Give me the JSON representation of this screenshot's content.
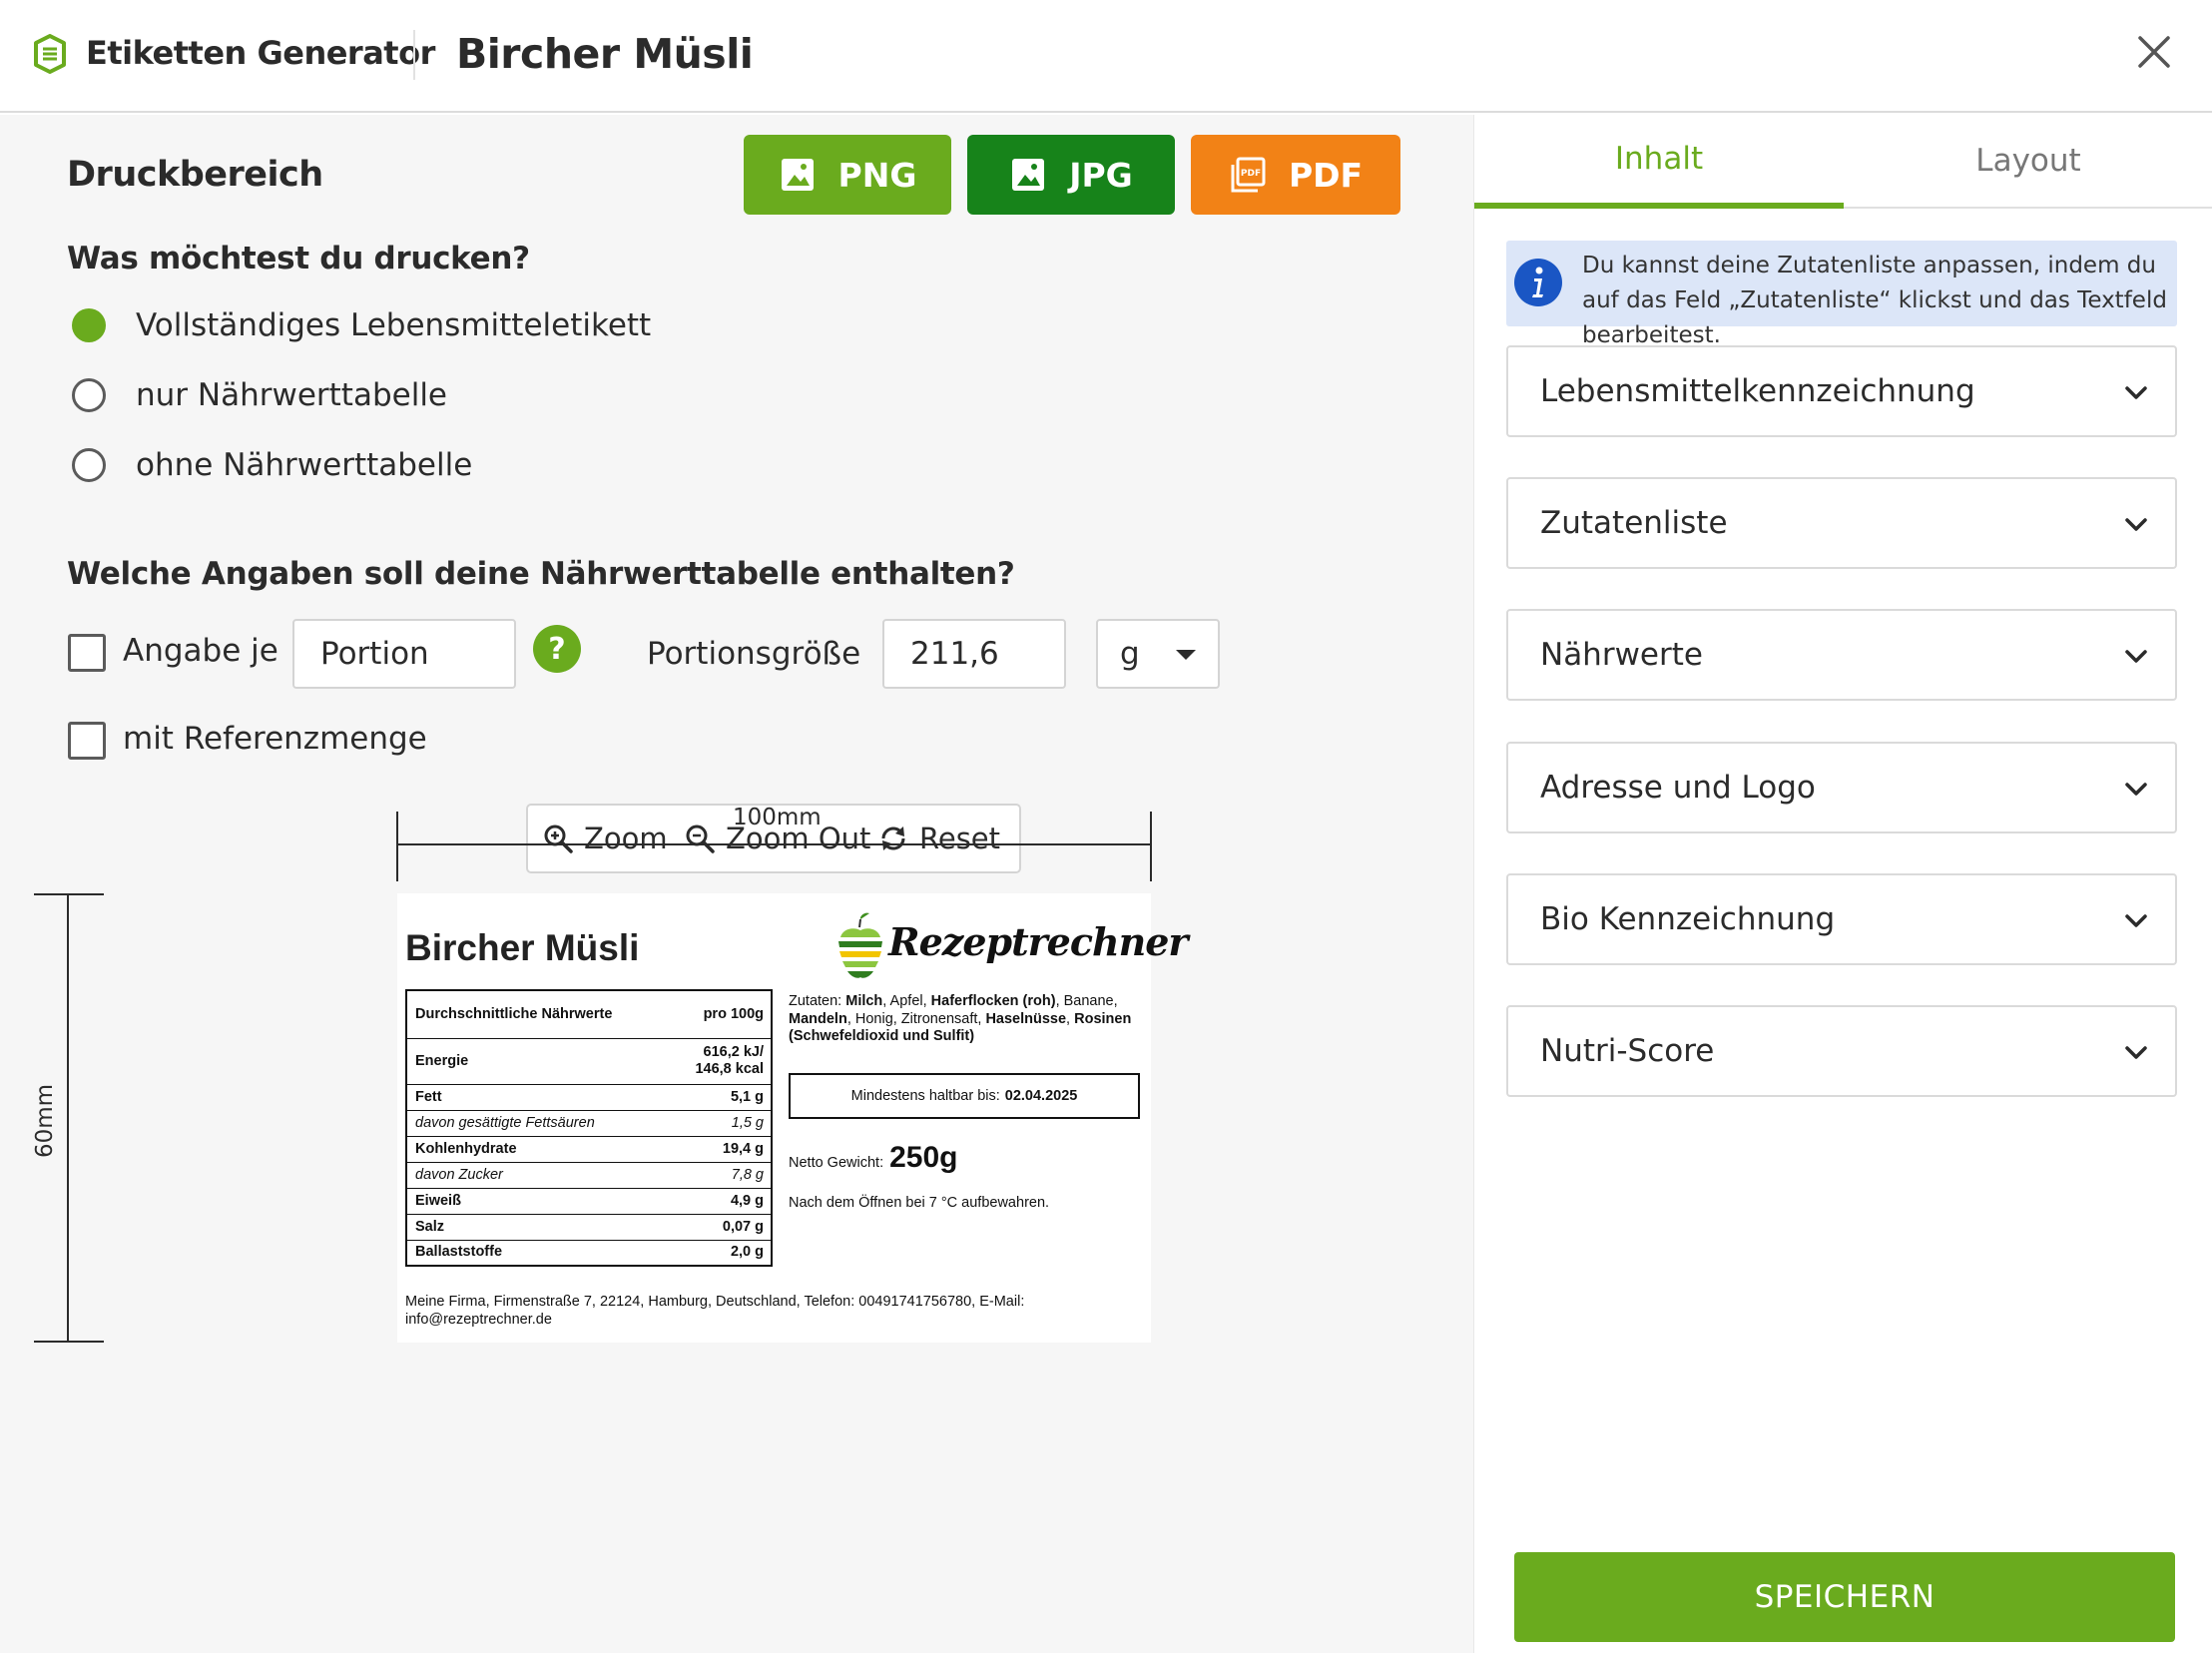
{
  "header": {
    "brand": "Etiketten Generator",
    "title": "Bircher Müsli"
  },
  "left": {
    "section_title": "Druckbereich",
    "export": {
      "png": "PNG",
      "jpg": "JPG",
      "pdf": "PDF"
    },
    "print_question": "Was möchtest du drucken?",
    "print_options": [
      {
        "label": "Vollständiges Lebensmitteletikett",
        "checked": true
      },
      {
        "label": "nur Nährwerttabelle",
        "checked": false
      },
      {
        "label": "ohne Nährwerttabelle",
        "checked": false
      }
    ],
    "nutrition_question": "Welche Angaben soll deine Nährwerttabelle enthalten?",
    "per_label": "Angabe je",
    "per_value": "Portion",
    "portion_size_label": "Portionsgröße",
    "portion_size_value": "211,6",
    "unit": "g",
    "reference_label": "mit Referenzmenge",
    "zoom": {
      "zoom_in": "Zoom",
      "zoom_out": "Zoom Out",
      "reset": "Reset"
    },
    "dim_width": "100mm",
    "dim_height": "60mm"
  },
  "label": {
    "title": "Bircher Müsli",
    "logo_text": "Rezeptrechner",
    "nutrition": {
      "header_left": "Durchschnittliche Nährwerte",
      "header_right": "pro 100g",
      "energy_label": "Energie",
      "energy_kj": "616,2 kJ/",
      "energy_kcal": "146,8 kcal",
      "rows": [
        {
          "label": "Fett",
          "value": "5,1 g",
          "type": "bold"
        },
        {
          "label": "davon gesättigte Fettsäuren",
          "value": "1,5 g",
          "type": "sub"
        },
        {
          "label": "Kohlenhydrate",
          "value": "19,4 g",
          "type": "bold"
        },
        {
          "label": "davon Zucker",
          "value": "7,8 g",
          "type": "sub"
        },
        {
          "label": "Eiweiß",
          "value": "4,9 g",
          "type": "bold"
        },
        {
          "label": "Salz",
          "value": "0,07 g",
          "type": "bold"
        },
        {
          "label": "Ballaststoffe",
          "value": "2,0 g",
          "type": "bold"
        }
      ]
    },
    "ingredients": [
      {
        "text": "Zutaten: ",
        "bold": false
      },
      {
        "text": "Milch",
        "bold": true
      },
      {
        "text": ", Apfel, ",
        "bold": false
      },
      {
        "text": "Haferflocken (roh)",
        "bold": true
      },
      {
        "text": ", Banane, ",
        "bold": false
      },
      {
        "text": "Mandeln",
        "bold": true
      },
      {
        "text": ", Honig, Zitronensaft, ",
        "bold": false
      },
      {
        "text": "Haselnüsse",
        "bold": true
      },
      {
        "text": ", ",
        "bold": false
      },
      {
        "text": "Rosinen (Schwefeldioxid und Sulfit)",
        "bold": true
      }
    ],
    "mhd_label": "Mindestens haltbar bis:",
    "mhd_value": "02.04.2025",
    "netto_label": "Netto Gewicht:",
    "netto_value": "250g",
    "storage": "Nach dem Öffnen bei 7 °C aufbewahren.",
    "address": "Meine Firma, Firmenstraße 7, 22124, Hamburg, Deutschland, Telefon: 00491741756780, E-Mail: info@rezeptrechner.de"
  },
  "right": {
    "tabs": {
      "inhalt": "Inhalt",
      "layout": "Layout"
    },
    "info": "Du kannst deine Zutatenliste anpassen, indem du auf das Feld „Zutatenliste“ klickst und das Textfeld bearbeitest.",
    "accordions": [
      "Lebensmittelkennzeichnung",
      "Zutatenliste",
      "Nährwerte",
      "Adresse und Logo",
      "Bio Kennzeichnung",
      "Nutri-Score"
    ],
    "save": "SPEICHERN"
  },
  "colors": {
    "accent_green": "#6aab1e",
    "dark_green": "#17831a",
    "orange": "#f28216",
    "info_blue": "#1a56c4"
  },
  "icons": {
    "brand": "label-logo-icon",
    "close": "close-icon",
    "export": "image-icon",
    "pdf": "pdf-icon",
    "help": "help-icon",
    "zoom_in": "zoom-in-icon",
    "zoom_out": "zoom-out-icon",
    "reset": "reset-icon",
    "info": "info-icon",
    "chevron": "chevron-down-icon"
  }
}
